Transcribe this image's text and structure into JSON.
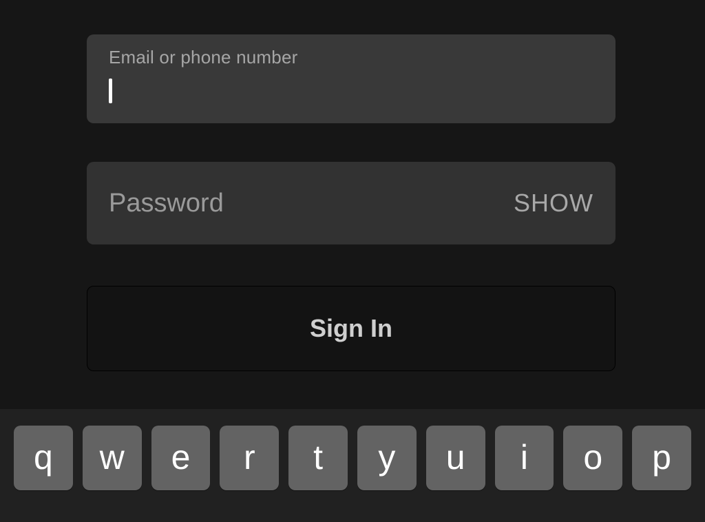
{
  "form": {
    "email": {
      "label": "Email or phone number",
      "value": ""
    },
    "password": {
      "placeholder": "Password",
      "show_label": "SHOW",
      "value": ""
    },
    "signin_label": "Sign In"
  },
  "keyboard": {
    "row1": [
      "q",
      "w",
      "e",
      "r",
      "t",
      "y",
      "u",
      "i",
      "o",
      "p"
    ]
  }
}
